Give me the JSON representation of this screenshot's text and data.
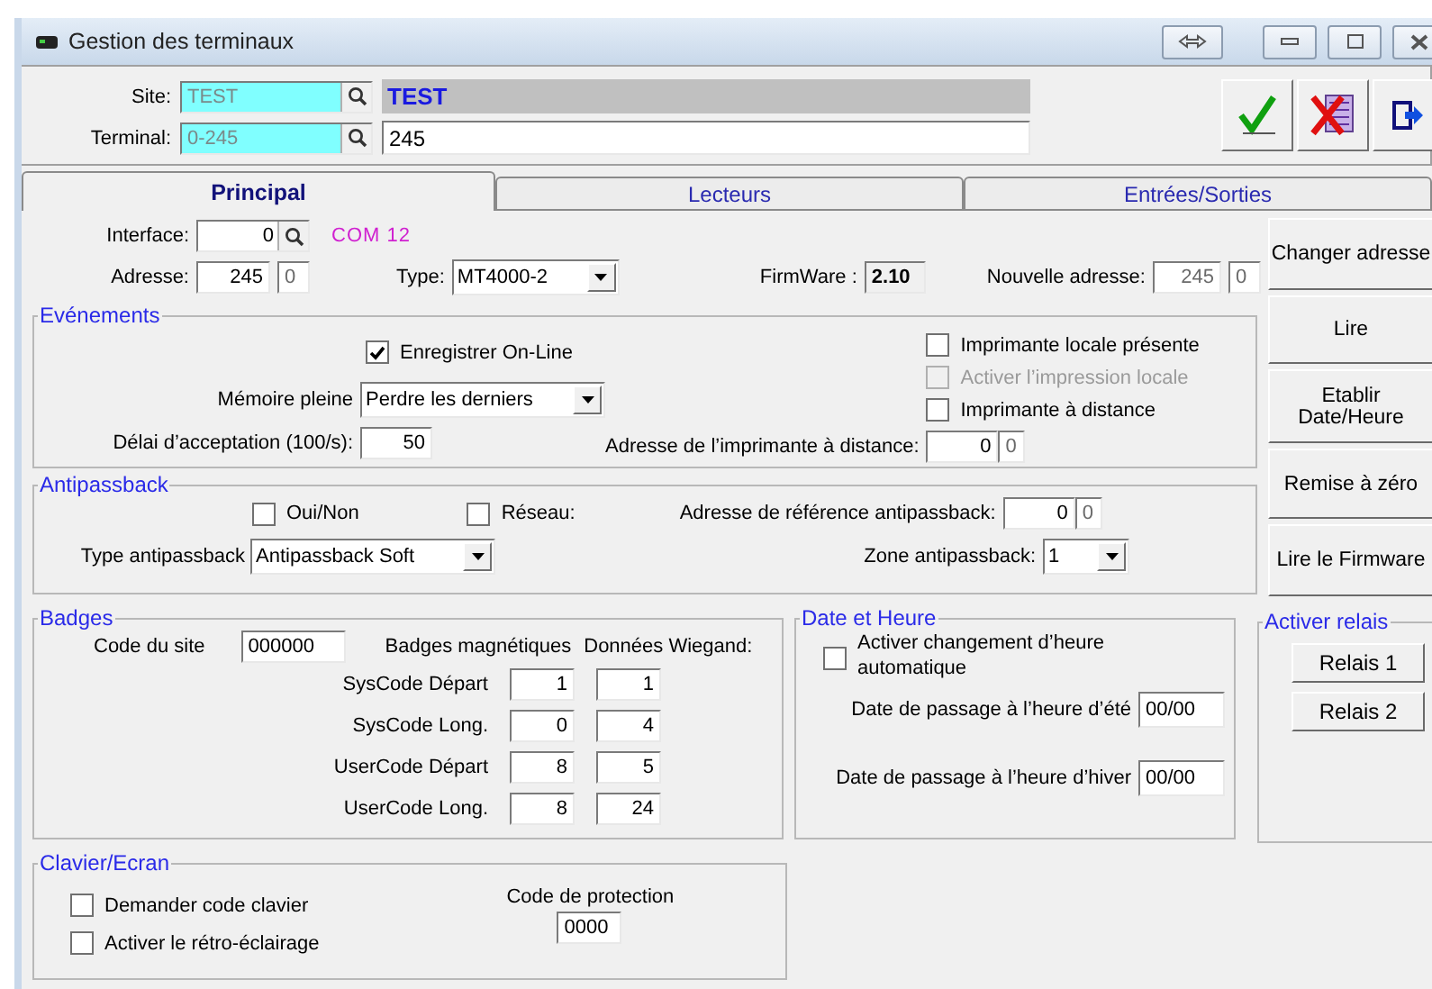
{
  "window": {
    "title": "Gestion des terminaux"
  },
  "header": {
    "site": {
      "label": "Site:",
      "code": "TEST",
      "name": "TEST"
    },
    "terminal": {
      "label": "Terminal:",
      "code": "0-245",
      "name": "245"
    }
  },
  "tabs": [
    {
      "label": "Principal",
      "selected": true
    },
    {
      "label": "Lecteurs",
      "selected": false
    },
    {
      "label": "Entrées/Sorties",
      "selected": false
    }
  ],
  "general": {
    "interface": {
      "label": "Interface:",
      "value": "0",
      "port": "COM 12"
    },
    "address": {
      "label": "Adresse:",
      "value": "245",
      "sub": "0"
    },
    "type": {
      "label": "Type:",
      "value": "MT4000-2"
    },
    "firmware": {
      "label": "FirmWare :",
      "value": "2.10"
    },
    "new_address": {
      "label": "Nouvelle adresse:",
      "value": "245",
      "sub": "0"
    }
  },
  "events": {
    "title": "Evénements",
    "online": {
      "label": "Enregistrer On-Line",
      "checked": true,
      "disabled": false
    },
    "memory": {
      "label": "Mémoire pleine",
      "value": "Perdre les derniers"
    },
    "delay": {
      "label": "Délai d’acceptation (100/s):",
      "value": "50"
    },
    "printer_checks": [
      {
        "label": "Imprimante locale présente",
        "checked": false,
        "disabled": false
      },
      {
        "label": "Activer l’impression locale",
        "checked": false,
        "disabled": true
      },
      {
        "label": "Imprimante à distance",
        "checked": false,
        "disabled": false
      }
    ],
    "printer_address": {
      "label": "Adresse de l’imprimante à distance:",
      "value": "0",
      "sub": "0"
    }
  },
  "antipassback": {
    "title": "Antipassback",
    "checks": [
      {
        "label": "Oui/Non",
        "checked": false
      },
      {
        "label": "Réseau:",
        "checked": false
      }
    ],
    "type": {
      "label": "Type antipassback",
      "value": "Antipassback Soft"
    },
    "reference": {
      "label": "Adresse de référence antipassback:",
      "value": "0",
      "sub": "0"
    },
    "zone": {
      "label": "Zone antipassback:",
      "value": "1"
    }
  },
  "badges": {
    "title": "Badges",
    "site_code": {
      "label": "Code du site",
      "value": "000000"
    },
    "columns": [
      "Badges magnétiques",
      "Données Wiegand:"
    ],
    "rows": [
      {
        "label": "SysCode Départ",
        "magnetic": "1",
        "wiegand": "1"
      },
      {
        "label": "SysCode Long.",
        "magnetic": "0",
        "wiegand": "4"
      },
      {
        "label": "UserCode Départ",
        "magnetic": "8",
        "wiegand": "5"
      },
      {
        "label": "UserCode Long.",
        "magnetic": "8",
        "wiegand": "24"
      }
    ]
  },
  "date_time": {
    "title": "Date et Heure",
    "auto": {
      "label": "Activer changement d’heure automatique",
      "checked": false
    },
    "dates": [
      {
        "label": "Date de passage à l’heure d’été",
        "value": "00/00"
      },
      {
        "label": "Date de passage à l’heure d’hiver",
        "value": "00/00"
      }
    ]
  },
  "keyboard": {
    "title": "Clavier/Ecran",
    "checks": [
      {
        "label": "Demander code clavier",
        "checked": false
      },
      {
        "label": "Activer le rétro-éclairage",
        "checked": false
      }
    ],
    "protection": {
      "label": "Code de protection",
      "value": "0000"
    }
  },
  "actions": [
    "Changer adresse",
    "Lire",
    "Etablir\nDate/Heure",
    "Remise à zéro",
    "Lire le Firmware"
  ],
  "relays": {
    "title": "Activer relais",
    "buttons": [
      "Relais 1",
      "Relais 2"
    ]
  }
}
